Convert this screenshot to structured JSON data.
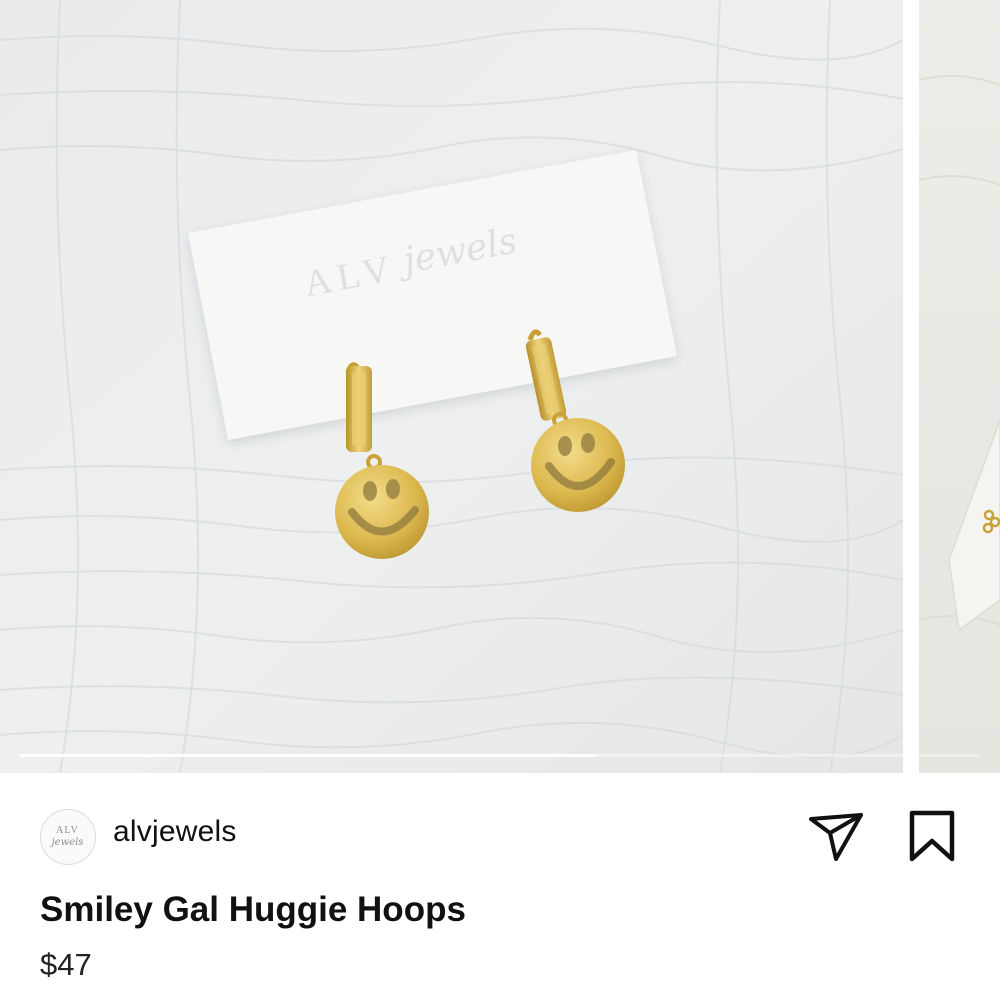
{
  "post": {
    "username": "alvjewels",
    "product_title": "Smiley Gal Huggie Hoops",
    "price": "$47"
  },
  "photo": {
    "card_brand_text": "ALV",
    "card_brand_script": "jewels"
  },
  "avatar": {
    "logo_text": "ALV",
    "logo_script": "jewels"
  },
  "carousel": {
    "progress": 0.6,
    "slide_count_visible": 2
  },
  "icons": {
    "share": "paper-plane-icon",
    "save": "bookmark-icon"
  },
  "colors": {
    "text": "#111111",
    "gold": "#d8b54a",
    "fabric": "#e7e9ea"
  }
}
